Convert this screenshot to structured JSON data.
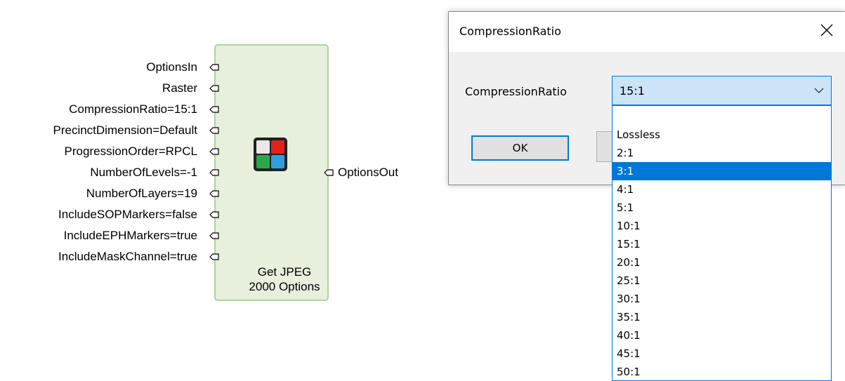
{
  "node": {
    "title": "Get JPEG 2000 Options",
    "inputs": [
      "OptionsIn",
      "Raster",
      "CompressionRatio=15:1",
      "PrecinctDimension=Default",
      "ProgressionOrder=RPCL",
      "NumberOfLevels=-1",
      "NumberOfLayers=19",
      "IncludeSOPMarkers=false",
      "IncludeEPHMarkers=true",
      "IncludeMaskChannel=true"
    ],
    "output": "OptionsOut",
    "icon": "quad-color-grid-icon",
    "icon_colors": [
      "#e8e8e8",
      "#e2231a",
      "#2aa84a",
      "#2f9fe0"
    ]
  },
  "dialog": {
    "title": "CompressionRatio",
    "field_label": "CompressionRatio",
    "selected_value": "15:1",
    "ok_label": "OK",
    "close_icon": "close-icon",
    "dropdown_icon": "chevron-down-icon",
    "options": [
      "Lossless",
      "2:1",
      "3:1",
      "4:1",
      "5:1",
      "10:1",
      "15:1",
      "20:1",
      "25:1",
      "30:1",
      "35:1",
      "40:1",
      "45:1",
      "50:1"
    ],
    "highlighted_option": "3:1"
  },
  "colors": {
    "node_fill": "#e6f0dc",
    "node_border": "#b4d1a0",
    "accent": "#0078d7",
    "combo_fill": "#cce4f7"
  }
}
